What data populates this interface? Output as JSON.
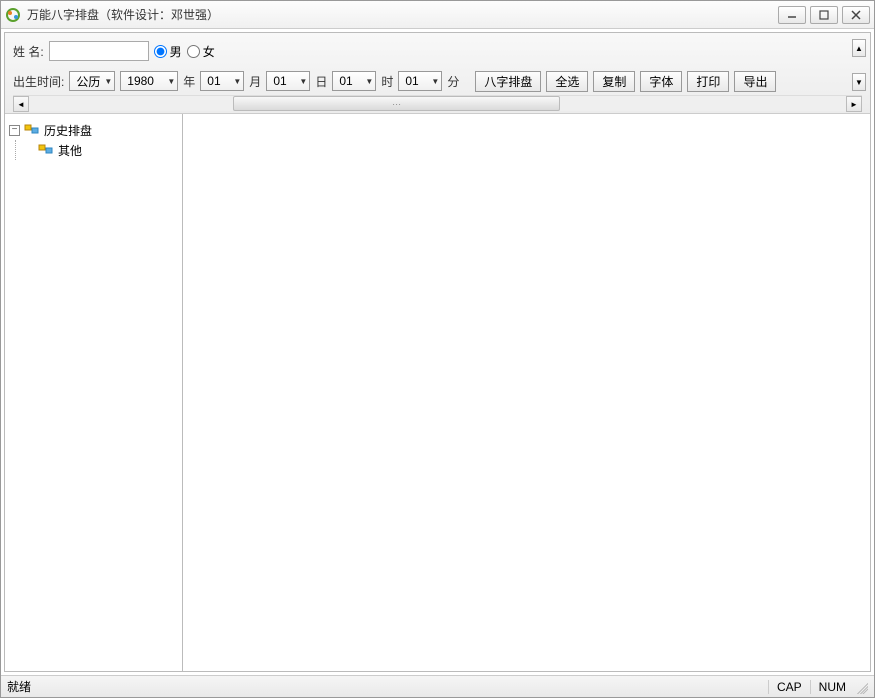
{
  "window": {
    "title": "万能八字排盘（软件设计：邓世强）"
  },
  "form": {
    "name_label": "姓    名:",
    "gender_male": "男",
    "gender_female": "女",
    "gender_selected": "male",
    "birth_label": "出生时间:",
    "calendar_type": "公历",
    "year": "1980",
    "year_suffix": "年",
    "month": "01",
    "month_suffix": "月",
    "day": "01",
    "day_suffix": "日",
    "hour": "01",
    "hour_suffix": "时",
    "minute": "01",
    "minute_suffix": "分"
  },
  "buttons": {
    "calc": "八字排盘",
    "select_all": "全选",
    "copy": "复制",
    "font": "字体",
    "print": "打印",
    "export": "导出"
  },
  "tree": {
    "root": "历史排盘",
    "child": "其他"
  },
  "status": {
    "ready": "就绪",
    "cap": "CAP",
    "num": "NUM"
  }
}
